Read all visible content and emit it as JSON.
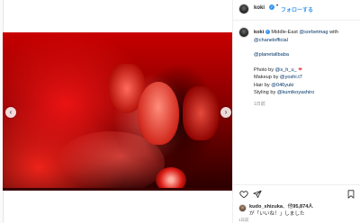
{
  "header": {
    "username": "koki",
    "verified_icon": "✓",
    "separator": "•",
    "follow_label": "フォローする"
  },
  "post": {
    "media_alt": "Red-lit portrait photo",
    "nav_prev": "‹",
    "nav_next": "›"
  },
  "caption": {
    "username": "koki",
    "verified_icon": "✓",
    "line1_text": " Middle-East ",
    "line1_mention": "@sorbetmag",
    "line1_end": " with",
    "line2_mention": "@chanelofficial",
    "line3_mention": "@planetalibaba",
    "line4_text": "Photo by ",
    "line4_mention": "@s_h_u_",
    "line4_heart": " ❤",
    "line5_text": "Makeup by ",
    "line5_mention": "@yoshi.t7",
    "line6_text": "Hair by ",
    "line6_mention": "@046yuki",
    "line7_text": "Styling by ",
    "line7_mention": "@kumikoyashiro",
    "timestamp": "1日前"
  },
  "likes": {
    "liker": "kudo_shizuka",
    "text_mid": "、他",
    "count": "95,874人",
    "text_end": "が「いいね！」しました"
  },
  "footer": {
    "timestamp": "1日前"
  },
  "icons": {
    "heart": "heart-icon",
    "share": "share-icon",
    "save": "bookmark-icon"
  },
  "colors": {
    "accent": "#3897f0",
    "link": "#003569",
    "muted": "#8e8e8e"
  }
}
